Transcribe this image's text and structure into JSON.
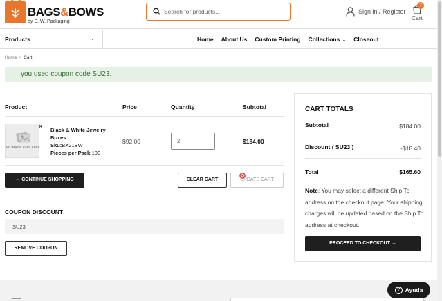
{
  "brand": {
    "name_part1": "BAGS",
    "name_amp": "&",
    "name_part2": "BOWS",
    "tagline": "by S. W. Packaging"
  },
  "search": {
    "placeholder": "Search for products..."
  },
  "account": {
    "signin_label": "Sign in / Register"
  },
  "cart_header": {
    "label": "Cart",
    "count": "2"
  },
  "nav": {
    "products_label": "Products",
    "items": [
      "Home",
      "About Us",
      "Custom Printing",
      "Collections",
      "Closeout"
    ]
  },
  "breadcrumb": {
    "home": "Home",
    "separator": ">",
    "current": "Cart"
  },
  "notice": {
    "message": "you used coupon code SU23."
  },
  "table": {
    "headers": {
      "product": "Product",
      "price": "Price",
      "quantity": "Quantity",
      "subtotal": "Subtotal"
    },
    "rows": [
      {
        "image_text": "NO IMAGE AVAILABLE",
        "name": "Black & White Jewelry Boxes",
        "sku_label": "Sku:",
        "sku": "BX21BW",
        "pack_label": "Pieces per Pack:",
        "pack": "100",
        "price": "$92.00",
        "quantity": "2",
        "subtotal": "$184.00"
      }
    ]
  },
  "buttons": {
    "continue_shopping": "← CONTINUE SHOPPING",
    "clear_cart": "CLEAR CART",
    "update_cart": "UPDATE CART",
    "remove_coupon": "REMOVE COUPON",
    "checkout": "PROCEED TO CHECKOUT →"
  },
  "coupon": {
    "title": "COUPON DISCOUNT",
    "value": "SU23"
  },
  "totals": {
    "title": "CART TOTALS",
    "subtotal_label": "Subtotal",
    "subtotal_value": "$184.00",
    "discount_label": "Discount ( SU23 )",
    "discount_value": "-$18.40",
    "total_label": "Total",
    "total_value": "$165.60",
    "note_label": "Note",
    "note_text": ": You may select a different Ship To address on the checkout page. Your shipping charges will be updated based on the Ship To address at checkout."
  },
  "help": {
    "label": "Ayuda"
  },
  "colors": {
    "accent": "#e8762d",
    "notice_bg": "#e6f1e6",
    "notice_text": "#2f6b2f",
    "dark_button": "#1f1f1f"
  }
}
